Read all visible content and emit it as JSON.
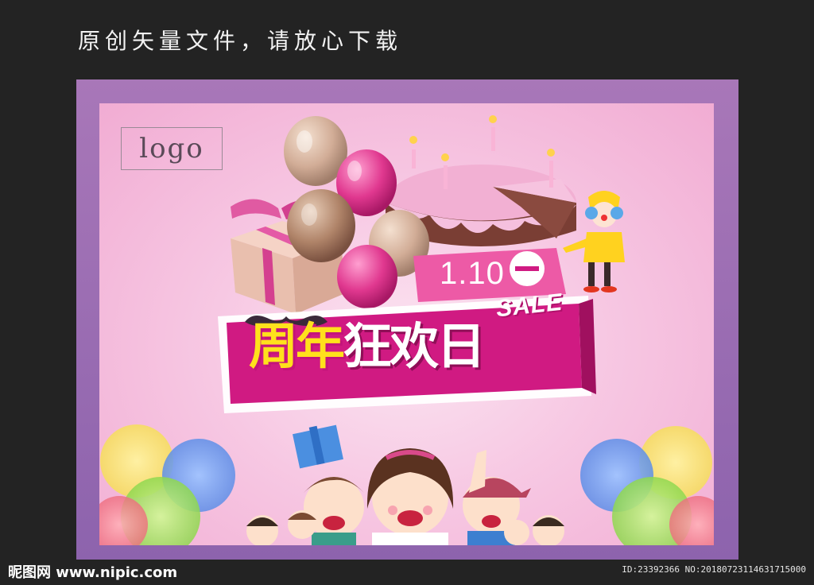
{
  "caption": "原创矢量文件，请放心下载",
  "poster": {
    "logo_text": "logo",
    "date_text": "1.10",
    "dash_text": "一",
    "title_part1": "周年",
    "title_part2": "狂欢日",
    "sale_text": "SALE"
  },
  "watermark": {
    "site": "昵图网 www.nipic.com",
    "id_line": "ID:23392366 NO:20180723114631715000"
  },
  "colors": {
    "background": "#232323",
    "frame": "#9a6db3",
    "poster_pink": "#f7c8e3",
    "banner_magenta": "#d01a82",
    "title_yellow": "#ffe11c"
  }
}
